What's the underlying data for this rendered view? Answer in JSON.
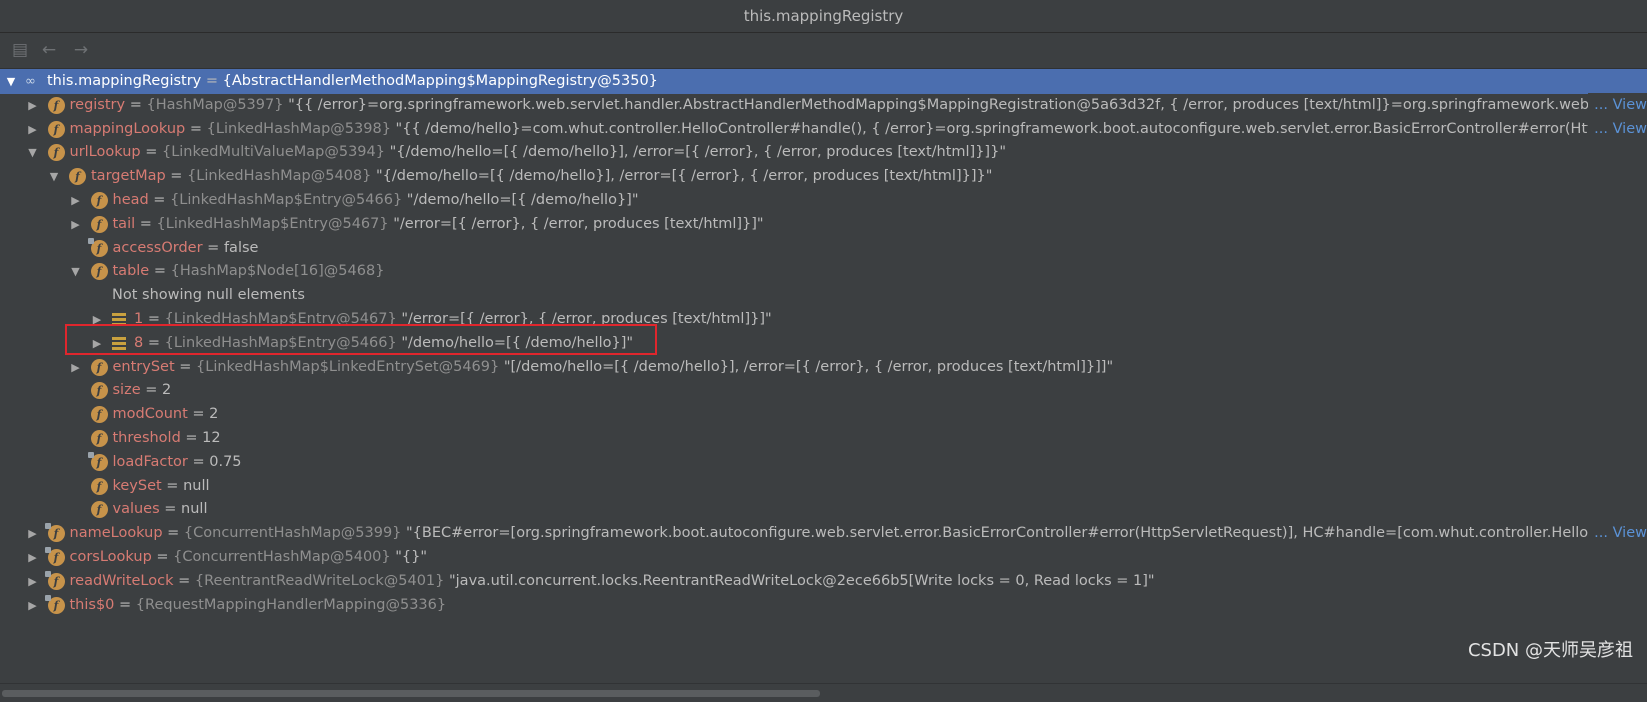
{
  "window": {
    "title": "this.mappingRegistry"
  },
  "toolbar": {
    "icons": [
      "watch-panel-icon",
      "back-arrow-icon",
      "forward-arrow-icon"
    ]
  },
  "tree": {
    "rows": [
      {
        "arrow": "▼",
        "icon": "watch",
        "name": "this.mappingRegistry",
        "eq": " = ",
        "type": "{AbstractHandlerMethodMapping$MappingRegistry@5350}",
        "value": "",
        "view": ""
      },
      {
        "arrow": "▶",
        "icon": "field",
        "name": "registry",
        "eq": " = ",
        "type": "{HashMap@5397} ",
        "value": "\"{{ /error}=org.springframework.web.servlet.handler.AbstractHandlerMethodMapping$MappingRegistration@5a63d32f, { /error, produces [text/html]}=org.springframework.web.s",
        "view": "... View"
      },
      {
        "arrow": "▶",
        "icon": "field",
        "name": "mappingLookup",
        "eq": " = ",
        "type": "{LinkedHashMap@5398} ",
        "value": "\"{{ /demo/hello}=com.whut.controller.HelloController#handle(), { /error}=org.springframework.boot.autoconfigure.web.servlet.error.BasicErrorController#error(Htt",
        "view": "... View"
      },
      {
        "arrow": "▼",
        "icon": "field",
        "name": "urlLookup",
        "eq": " = ",
        "type": "{LinkedMultiValueMap@5394} ",
        "value": "\"{/demo/hello=[{ /demo/hello}], /error=[{ /error}, { /error, produces [text/html]}]}\"",
        "view": ""
      },
      {
        "arrow": "▼",
        "icon": "field",
        "name": "targetMap",
        "eq": " = ",
        "type": "{LinkedHashMap@5408} ",
        "value": "\"{/demo/hello=[{ /demo/hello}], /error=[{ /error}, { /error, produces [text/html]}]}\"",
        "view": ""
      },
      {
        "arrow": "▶",
        "icon": "field",
        "name": "head",
        "eq": " = ",
        "type": "{LinkedHashMap$Entry@5466} ",
        "value": "\"/demo/hello=[{ /demo/hello}]\"",
        "view": ""
      },
      {
        "arrow": "▶",
        "icon": "field",
        "name": "tail",
        "eq": " = ",
        "type": "{LinkedHashMap$Entry@5467} ",
        "value": "\"/error=[{ /error}, { /error, produces [text/html]}]\"",
        "view": ""
      },
      {
        "arrow": "",
        "icon": "field-lock",
        "name": "accessOrder",
        "eq": " = ",
        "type": "",
        "value": "false",
        "view": ""
      },
      {
        "arrow": "▼",
        "icon": "field",
        "name": "table",
        "eq": " = ",
        "type": "{HashMap$Node[16]@5468}",
        "value": "",
        "view": ""
      },
      {
        "arrow": "",
        "icon": "none",
        "name": "",
        "eq": "",
        "type": "",
        "value": "Not showing null elements",
        "view": ""
      },
      {
        "arrow": "▶",
        "icon": "array",
        "name": "1",
        "eq": " = ",
        "type": "{LinkedHashMap$Entry@5467} ",
        "value": "\"/error=[{ /error}, { /error, produces [text/html]}]\"",
        "view": ""
      },
      {
        "arrow": "▶",
        "icon": "array",
        "name": "8",
        "eq": " = ",
        "type": "{LinkedHashMap$Entry@5466} ",
        "value": "\"/demo/hello=[{ /demo/hello}]\"",
        "view": ""
      },
      {
        "arrow": "▶",
        "icon": "field",
        "name": "entrySet",
        "eq": " = ",
        "type": "{LinkedHashMap$LinkedEntrySet@5469} ",
        "value": "\"[/demo/hello=[{ /demo/hello}], /error=[{ /error}, { /error, produces [text/html]}]]\"",
        "view": ""
      },
      {
        "arrow": "",
        "icon": "field",
        "name": "size",
        "eq": " = ",
        "type": "",
        "value": "2",
        "view": ""
      },
      {
        "arrow": "",
        "icon": "field",
        "name": "modCount",
        "eq": " = ",
        "type": "",
        "value": "2",
        "view": ""
      },
      {
        "arrow": "",
        "icon": "field",
        "name": "threshold",
        "eq": " = ",
        "type": "",
        "value": "12",
        "view": ""
      },
      {
        "arrow": "",
        "icon": "field-lock",
        "name": "loadFactor",
        "eq": " = ",
        "type": "",
        "value": "0.75",
        "view": ""
      },
      {
        "arrow": "",
        "icon": "field",
        "name": "keySet",
        "eq": " = ",
        "type": "",
        "value": "null",
        "view": ""
      },
      {
        "arrow": "",
        "icon": "field",
        "name": "values",
        "eq": " = ",
        "type": "",
        "value": "null",
        "view": ""
      },
      {
        "arrow": "▶",
        "icon": "field-lock",
        "name": "nameLookup",
        "eq": " = ",
        "type": "{ConcurrentHashMap@5399} ",
        "value": "\"{BEC#error=[org.springframework.boot.autoconfigure.web.servlet.error.BasicErrorController#error(HttpServletRequest)], HC#handle=[com.whut.controller.Hello",
        "view": "... View"
      },
      {
        "arrow": "▶",
        "icon": "field-lock",
        "name": "corsLookup",
        "eq": " = ",
        "type": "{ConcurrentHashMap@5400} ",
        "value": "\"{}\"",
        "view": ""
      },
      {
        "arrow": "▶",
        "icon": "field-lock",
        "name": "readWriteLock",
        "eq": " = ",
        "type": "{ReentrantReadWriteLock@5401} ",
        "value": "\"java.util.concurrent.locks.ReentrantReadWriteLock@2ece66b5[Write locks = 0, Read locks = 1]\"",
        "view": ""
      },
      {
        "arrow": "▶",
        "icon": "field-lock",
        "name": "this$0",
        "eq": " = ",
        "type": "{RequestMappingHandlerMapping@5336}",
        "value": "",
        "view": ""
      }
    ]
  },
  "watermark": "CSDN @天师吴彦祖"
}
